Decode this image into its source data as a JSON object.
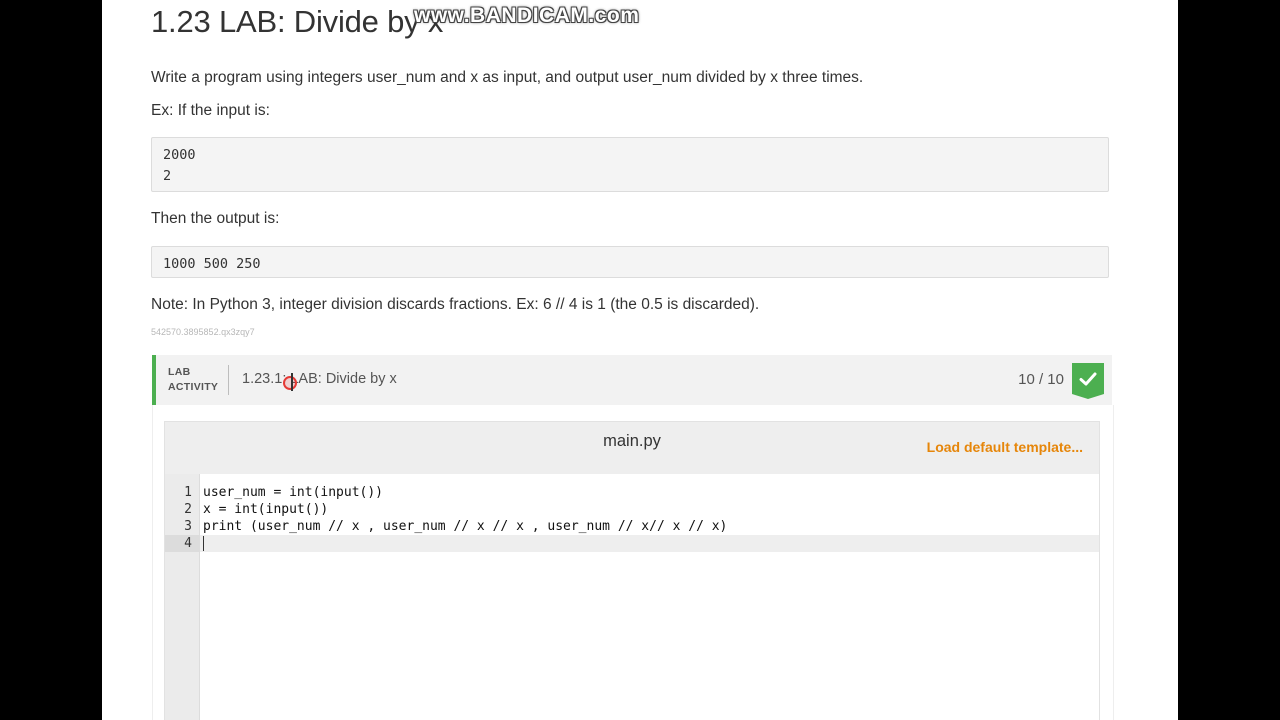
{
  "page": {
    "title": "1.23 LAB: Divide by x",
    "watermark": "www.BANDICAM.com",
    "description": "Write a program using integers user_num and x as input, and output user_num divided by x three times.",
    "example_input_label": "Ex: If the input is:",
    "example_input": "2000\n2",
    "example_output_label": "Then the output is:",
    "example_output": "1000 500 250",
    "note": "Note: In Python 3, integer division discards fractions. Ex: 6 // 4 is 1 (the 0.5 is discarded).",
    "content_id": "542570.3895852.qx3zqy7"
  },
  "lab": {
    "activity_label_1": "LAB",
    "activity_label_2": "ACTIVITY",
    "title": "1.23.1: LAB: Divide by x",
    "score": "10 / 10",
    "status_color": "#4caf50"
  },
  "editor": {
    "filename": "main.py",
    "load_template_label": "Load default template...",
    "lines": [
      {
        "num": "1",
        "code": "user_num = int(input())"
      },
      {
        "num": "2",
        "code": "x = int(input())"
      },
      {
        "num": "3",
        "code": "print (user_num // x , user_num // x // x , user_num // x// x // x)"
      },
      {
        "num": "4",
        "code": ""
      }
    ]
  },
  "colors": {
    "accent_green": "#4caf50",
    "link_orange": "#e6860a"
  }
}
